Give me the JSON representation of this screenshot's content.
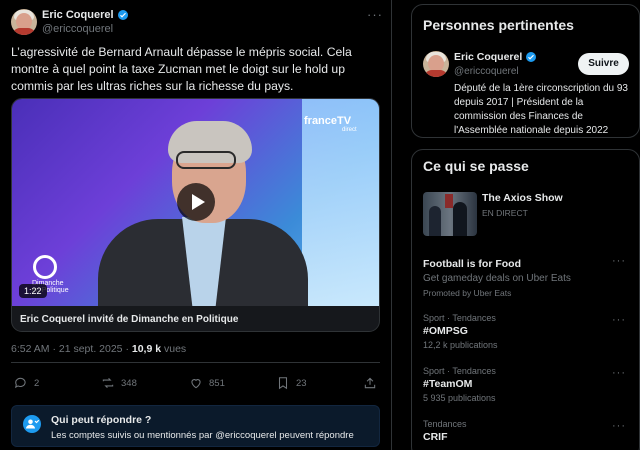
{
  "tweet": {
    "author_name": "Eric Coquerel",
    "author_handle": "@ericcoquerel",
    "more_label": "···",
    "text": "L’agressivité de Bernard Arnault dépasse le mépris social. Cela montre à quel point la taxe Zucman met le doigt sur le hold up commis par les ultras riches sur la richesse du pays.",
    "media": {
      "channel_logo": "franceTV",
      "channel_logo_sub": "direct",
      "show_logo_text": "Dimanche en Politique",
      "duration": "1:22",
      "caption": "Eric Coquerel invité de Dimanche en Politique"
    },
    "time": "6:52 AM",
    "separator": "·",
    "date": "21 sept. 2025",
    "views_count": "10,9 k",
    "views_label": "vues",
    "actions": {
      "replies": "2",
      "reposts": "348",
      "likes": "851",
      "bookmarks": "23"
    },
    "reply_restriction": {
      "title": "Qui peut répondre ?",
      "subtitle": "Les comptes suivis ou mentionnés par @ericcoquerel peuvent répondre"
    }
  },
  "relevant_people": {
    "title": "Personnes pertinentes",
    "name": "Eric Coquerel",
    "handle": "@ericcoquerel",
    "bio": "Député de la 1ère circonscription du 93 depuis 2017 | Président de la commission des Finances de l'Assemblée nationale depuis 2022",
    "follow_label": "Suivre"
  },
  "whats_happening": {
    "title": "Ce qui se passe",
    "live": {
      "title": "The Axios Show",
      "status": "EN DIRECT"
    },
    "trends": [
      {
        "context": "",
        "title": "Football is for Food",
        "subtitle": "Get gameday deals on Uber Eats",
        "footer": "Promoted by Uber Eats"
      },
      {
        "context": "Sport · Tendances",
        "title": "#OMPSG",
        "subtitle": "12,2 k publications"
      },
      {
        "context": "Sport · Tendances",
        "title": "#TeamOM",
        "subtitle": "5 935 publications"
      },
      {
        "context": "Tendances",
        "title": "CRIF",
        "subtitle": ""
      }
    ],
    "more_label": "···"
  },
  "colors": {
    "background": "#000000",
    "text": "#e7e9ea",
    "muted": "#71767b",
    "accent": "#1d9bf0",
    "border": "#2f3336"
  }
}
